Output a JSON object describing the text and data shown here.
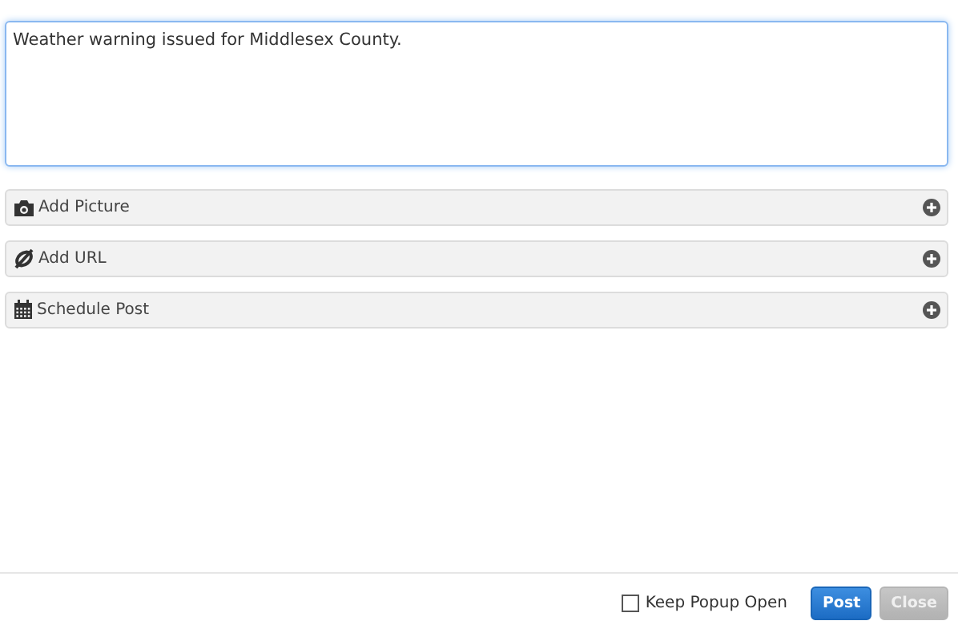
{
  "message": {
    "value": "Weather warning issued for Middlesex County."
  },
  "sections": [
    {
      "kind": "picture",
      "label": "Add Picture",
      "expanded": false
    },
    {
      "kind": "url",
      "label": "Add URL",
      "expanded": false
    },
    {
      "kind": "schedule",
      "label": "Schedule Post",
      "expanded": false
    }
  ],
  "keep_open": {
    "label": "Keep Popup Open",
    "checked": false
  },
  "buttons": [
    {
      "label": "Post",
      "kind": "primary",
      "disabled": false
    },
    {
      "label": "Close",
      "kind": "secondary",
      "disabled": true
    }
  ]
}
